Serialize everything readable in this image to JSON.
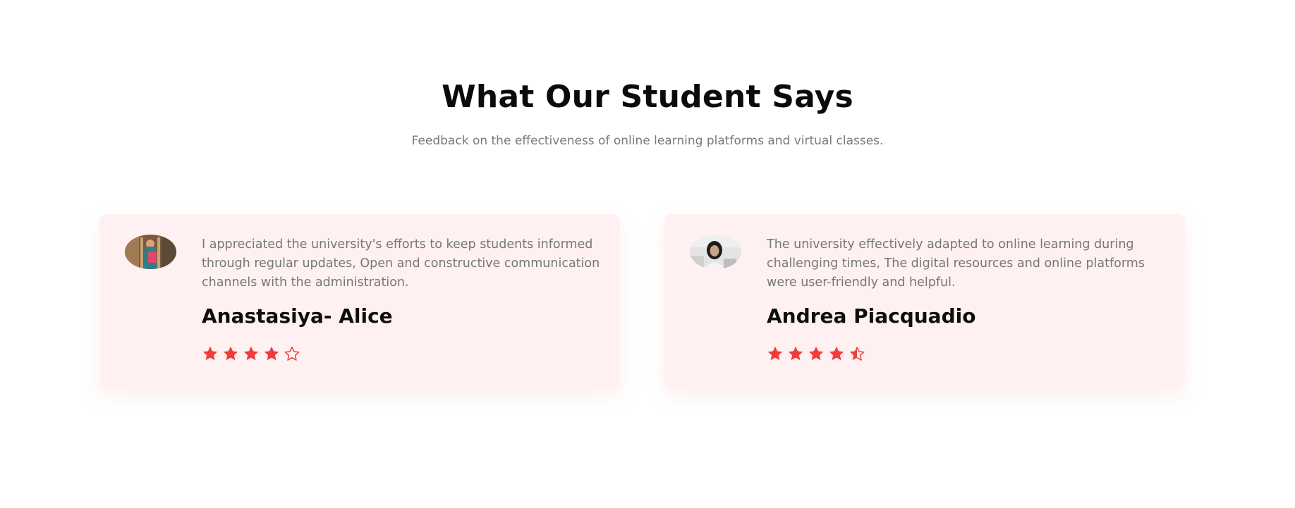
{
  "section": {
    "title": "What Our Student Says",
    "subtitle": "Feedback on the effectiveness of online learning platforms and virtual classes."
  },
  "colors": {
    "accent": "#f23c3c",
    "card_background": "#fff1f1",
    "heading": "#0b0b0b",
    "body_text": "#777777"
  },
  "testimonials": [
    {
      "quote": "I appreciated the university's efforts to keep students informed through regular updates, Open and constructive communication channels with the administration.",
      "name": "Anastasiya- Alice",
      "rating": 4,
      "max_rating": 5,
      "avatar_icon": "student-photo"
    },
    {
      "quote": "The university effectively adapted to online learning during challenging times, The digital resources and online platforms were user-friendly and helpful.",
      "name": "Andrea Piacquadio",
      "rating": 4.5,
      "max_rating": 5,
      "avatar_icon": "student-photo"
    }
  ]
}
